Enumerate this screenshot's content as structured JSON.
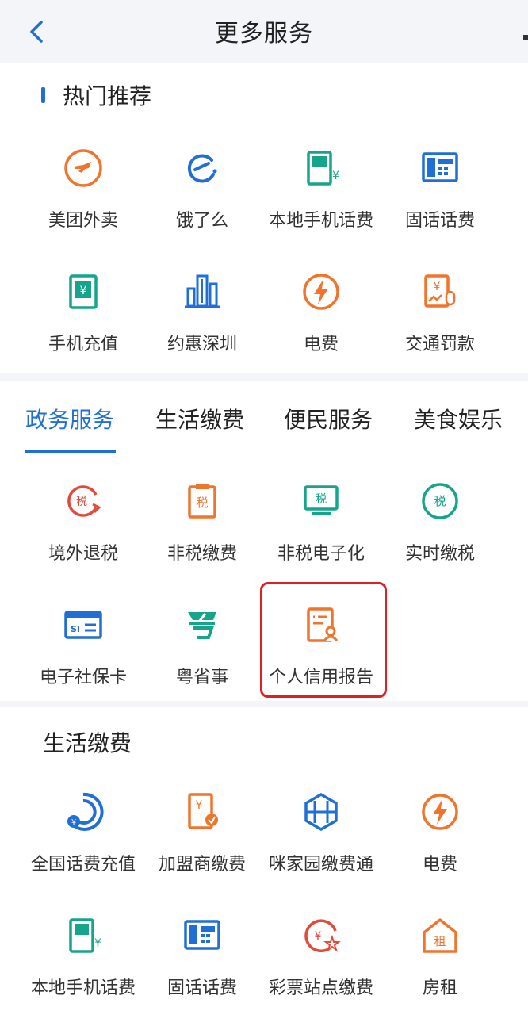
{
  "header": {
    "title": "更多服务"
  },
  "hot": {
    "title": "热门推荐",
    "items": [
      {
        "label": "美团外卖",
        "icon": "meituan-kangaroo-icon"
      },
      {
        "label": "饿了么",
        "icon": "eleme-icon"
      },
      {
        "label": "本地手机话费",
        "icon": "mobile-bill-icon"
      },
      {
        "label": "固话话费",
        "icon": "landline-phone-icon"
      },
      {
        "label": "手机充值",
        "icon": "mobile-recharge-icon"
      },
      {
        "label": "约惠深圳",
        "icon": "city-buildings-icon"
      },
      {
        "label": "电费",
        "icon": "lightning-icon"
      },
      {
        "label": "交通罚款",
        "icon": "traffic-fine-icon"
      }
    ]
  },
  "tabs": [
    {
      "label": "政务服务",
      "active": true
    },
    {
      "label": "生活缴费",
      "active": false
    },
    {
      "label": "便民服务",
      "active": false
    },
    {
      "label": "美食娱乐",
      "active": false
    }
  ],
  "gov": {
    "items": [
      {
        "label": "境外退税",
        "icon": "tax-refund-icon",
        "glyph": "税"
      },
      {
        "label": "非税缴费",
        "icon": "non-tax-payment-icon",
        "glyph": "税"
      },
      {
        "label": "非税电子化",
        "icon": "non-tax-electronic-icon",
        "glyph": "税"
      },
      {
        "label": "实时缴税",
        "icon": "realtime-tax-icon",
        "glyph": "税"
      },
      {
        "label": "电子社保卡",
        "icon": "social-security-card-icon",
        "glyph": "SI"
      },
      {
        "label": "粤省事",
        "icon": "yueshengshi-icon"
      },
      {
        "label": "个人信用报告",
        "icon": "credit-report-icon"
      }
    ]
  },
  "life": {
    "title": "生活缴费",
    "items": [
      {
        "label": "全国话费充值",
        "icon": "phone-recharge-icon"
      },
      {
        "label": "加盟商缴费",
        "icon": "franchise-payment-icon"
      },
      {
        "label": "咪家园缴费通",
        "icon": "hexagon-home-icon"
      },
      {
        "label": "电费",
        "icon": "lightning-icon"
      },
      {
        "label": "本地手机话费",
        "icon": "mobile-bill-icon"
      },
      {
        "label": "固话话费",
        "icon": "landline-phone-icon"
      },
      {
        "label": "彩票站点缴费",
        "icon": "lottery-icon"
      },
      {
        "label": "房租",
        "icon": "house-rent-icon",
        "glyph": "租"
      }
    ]
  },
  "colors": {
    "blue": "#1f6fd6",
    "orange": "#f0742b",
    "red": "#e24a3b",
    "teal": "#16a58c",
    "highlight": "#e02020"
  }
}
